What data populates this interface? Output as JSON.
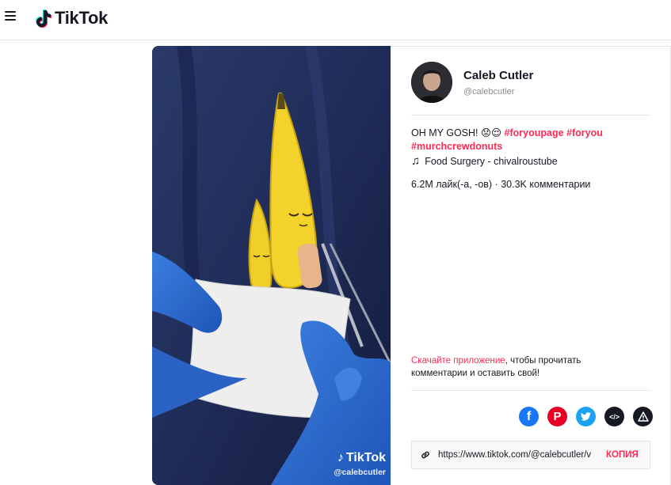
{
  "app": {
    "name": "TikTok"
  },
  "header": {
    "menu_icon": "hamburger-menu-icon",
    "logo_text": "TikTok"
  },
  "video": {
    "watermark_logo": "TikTok",
    "watermark_handle": "@calebcutler"
  },
  "author": {
    "name": "Caleb Cutler",
    "handle": "@calebcutler"
  },
  "caption": {
    "text": "OH MY GOSH! 😟😌 ",
    "tags": [
      "#foryoupage",
      "#foryou",
      "#murchcrewdonuts"
    ]
  },
  "music": {
    "icon": "music-note-icon",
    "title": "Food Surgery - chivalroustube"
  },
  "stats": {
    "text": "6.2M лайк(-а, -ов) · 30.3K комментарии"
  },
  "download_prompt": {
    "link_text": "Скачайте приложение",
    "rest_text": ", чтобы прочитать комментарии и оставить свой!"
  },
  "share": {
    "icons": [
      "facebook-icon",
      "pinterest-icon",
      "twitter-icon",
      "embed-icon",
      "report-icon"
    ]
  },
  "link": {
    "url": "https://www.tiktok.com/@calebcutler/v",
    "copy_label": "КОПИЯ"
  },
  "colors": {
    "accent": "#fe2c55",
    "text": "#161823",
    "muted": "#8a8b91"
  }
}
